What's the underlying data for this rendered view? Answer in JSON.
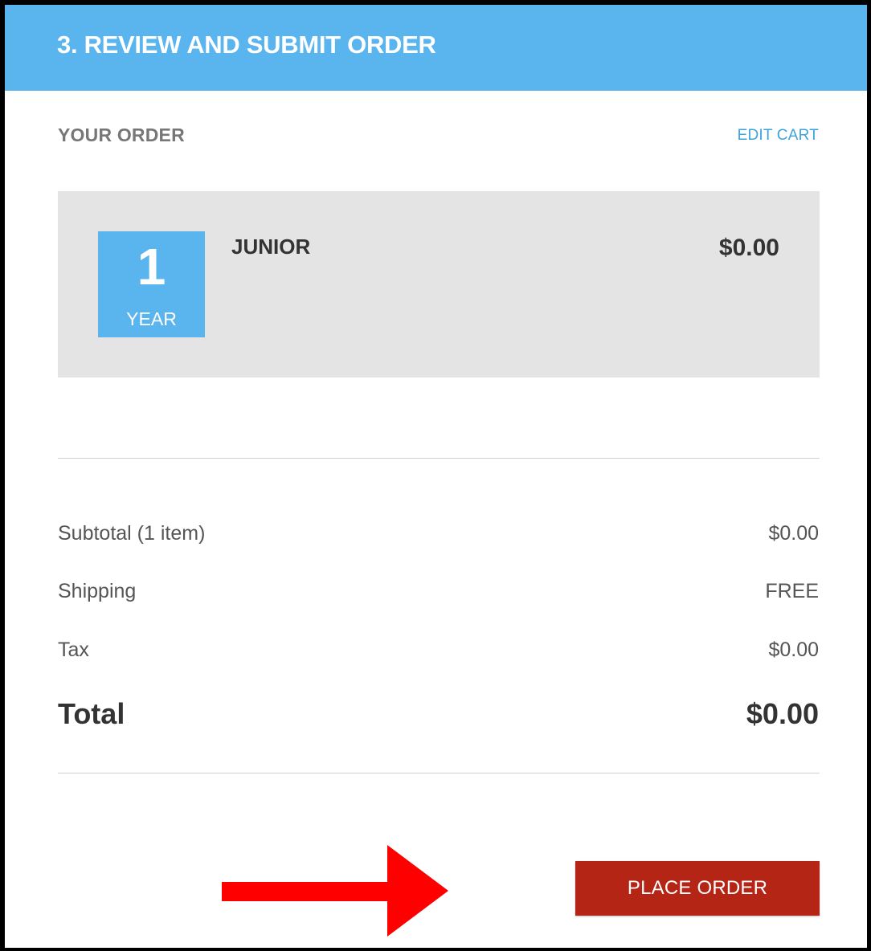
{
  "colors": {
    "header_bg": "#5ab4ee",
    "badge_bg": "#5ab4ee",
    "card_bg": "#e4e4e4",
    "link": "#3ea3dd",
    "button_bg": "#b52516",
    "annotation_arrow": "#ff0000"
  },
  "header": {
    "title": "3. REVIEW AND SUBMIT ORDER"
  },
  "order": {
    "heading": "YOUR ORDER",
    "edit_cart_label": "EDIT CART",
    "item": {
      "term_number": "1",
      "term_unit": "YEAR",
      "name": "JUNIOR",
      "price": "$0.00"
    }
  },
  "summary": {
    "subtotal": {
      "label": "Subtotal (1 item)",
      "value": "$0.00"
    },
    "shipping": {
      "label": "Shipping",
      "value": "FREE"
    },
    "tax": {
      "label": "Tax",
      "value": "$0.00"
    },
    "total": {
      "label": "Total",
      "value": "$0.00"
    }
  },
  "actions": {
    "place_order_label": "PLACE ORDER"
  },
  "annotation": {
    "icon": "right-arrow-icon"
  }
}
